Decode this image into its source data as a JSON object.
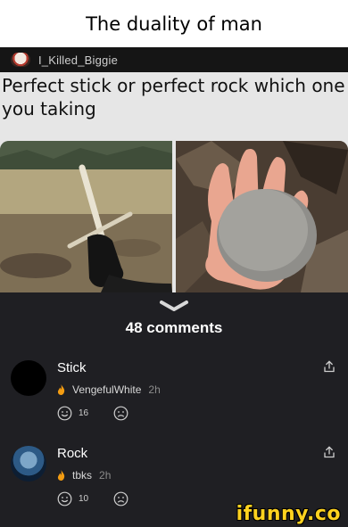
{
  "meme": {
    "title": "The duality of man"
  },
  "post": {
    "author": "I_Killed_Biggie",
    "text": "Perfect stick or perfect rock which one you taking"
  },
  "comments_header": {
    "count_label": "48 comments"
  },
  "comments": [
    {
      "text": "Stick",
      "username": "VengefulWhite",
      "time": "2h",
      "likes": "16",
      "avatar": "black-circle-avatar"
    },
    {
      "text": "Rock",
      "username": "tbks",
      "time": "2h",
      "likes": "10",
      "avatar": "planet-avatar"
    }
  ],
  "watermark": "ifunny.co",
  "colors": {
    "dark_bg": "#1f1f23",
    "flame": "#f39c12",
    "watermark": "#ffd21f"
  }
}
